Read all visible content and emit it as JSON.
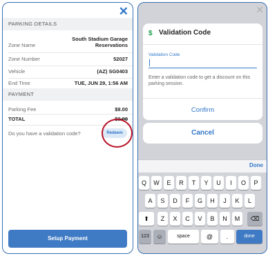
{
  "left": {
    "close_glyph": "✕",
    "parking_details_header": "PARKING DETAILS",
    "rows": [
      {
        "label": "Zone Name",
        "value": "South Stadium Garage Reservations"
      },
      {
        "label": "Zone Number",
        "value": "52027"
      },
      {
        "label": "Vehicle",
        "value": "(AZ) SG0403"
      },
      {
        "label": "End Time",
        "value": "TUE, JUN 29, 1:56 AM"
      }
    ],
    "payment_header": "PAYMENT",
    "parking_fee_label": "Parking Fee",
    "parking_fee_value": "$9.00",
    "total_label": "TOTAL",
    "total_value": "$9.00",
    "validation_question": "Do you have a validation code?",
    "redeem_label": "Redeem",
    "setup_payment_label": "Setup Payment"
  },
  "right": {
    "close_glyph": "✕",
    "dollar_glyph": "$",
    "title": "Validation Code",
    "field_label": "Validation Code",
    "field_value": "",
    "help_text": "Enter a validation code to get a discount on this parking session.",
    "confirm_label": "Confirm",
    "cancel_label": "Cancel",
    "done_label": "Done"
  },
  "keyboard": {
    "row1": [
      "Q",
      "W",
      "E",
      "R",
      "T",
      "Y",
      "U",
      "I",
      "O",
      "P"
    ],
    "row2": [
      "A",
      "S",
      "D",
      "F",
      "G",
      "H",
      "J",
      "K",
      "L"
    ],
    "row3": [
      "Z",
      "X",
      "C",
      "V",
      "B",
      "N",
      "M"
    ],
    "shift_glyph": "⬆",
    "backspace_glyph": "⌫",
    "numbers_label": "123",
    "emoji_glyph": "☺",
    "space_label": "space",
    "at_label": "@",
    "period_label": ".",
    "done_key_label": "done"
  },
  "colors": {
    "accent": "#2f76c9",
    "highlight_ring": "#b8152b",
    "dollar": "#1f9d4a",
    "button": "#3f7ac4"
  }
}
